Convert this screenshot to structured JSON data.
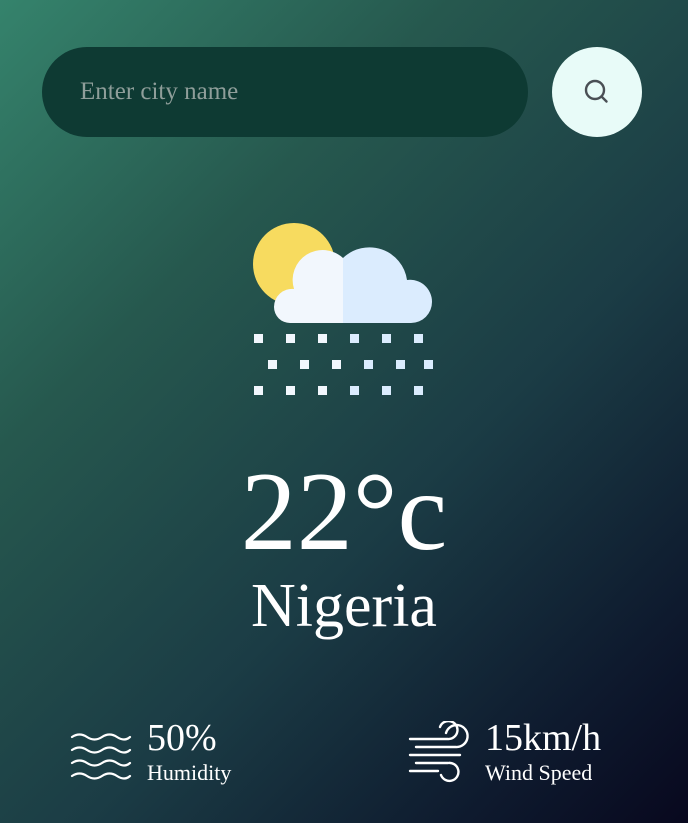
{
  "search": {
    "placeholder": "Enter city name",
    "value": "",
    "button_icon": "search-icon"
  },
  "weather": {
    "icon": "sun-cloud-snow-icon",
    "temperature": "22°c",
    "city": "Nigeria"
  },
  "details": {
    "humidity": {
      "icon": "humidity-waves-icon",
      "value": "50%",
      "label": "Humidity"
    },
    "wind": {
      "icon": "wind-icon",
      "value": "15km/h",
      "label": "Wind Speed"
    }
  },
  "colors": {
    "gradient_start": "#35836c",
    "gradient_end": "#08081e",
    "input_background": "#0e3a33",
    "search_button": "#e8fbf8",
    "sun": "#f7db5f",
    "cloud": "#f2f7fd",
    "cloud_shade": "#dbecfe"
  }
}
